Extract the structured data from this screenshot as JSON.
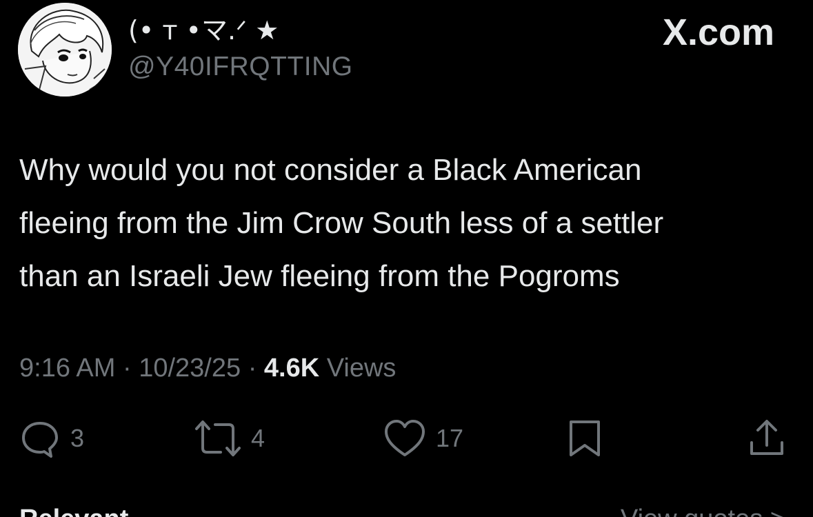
{
  "author": {
    "display_name": "(• ᴛ •マ.ᐟ ★",
    "handle": "@Y40IFRQTTING",
    "avatar_icon": "avatar-manga-portrait"
  },
  "brand": "X.com",
  "tweet": {
    "text_lines": [
      "Why would you not consider a Black American",
      "fleeing from the Jim Crow South less of a settler",
      "than an Israeli Jew fleeing from the Pogroms"
    ]
  },
  "meta": {
    "time": "9:16 AM",
    "date": "10/23/25",
    "views_count": "4.6K",
    "views_label": "Views",
    "separator": "·"
  },
  "actions": {
    "reply": {
      "icon": "reply-icon",
      "count": "3"
    },
    "repost": {
      "icon": "repost-icon",
      "count": "4"
    },
    "like": {
      "icon": "heart-icon",
      "count": "17"
    },
    "bookmark": {
      "icon": "bookmark-icon"
    },
    "share": {
      "icon": "share-icon"
    }
  },
  "bottom": {
    "left_label": "Relevant",
    "right_label": "View quotes >"
  },
  "colors": {
    "background": "#000000",
    "primary_text": "#e7e9ea",
    "secondary_text": "#71767b"
  }
}
